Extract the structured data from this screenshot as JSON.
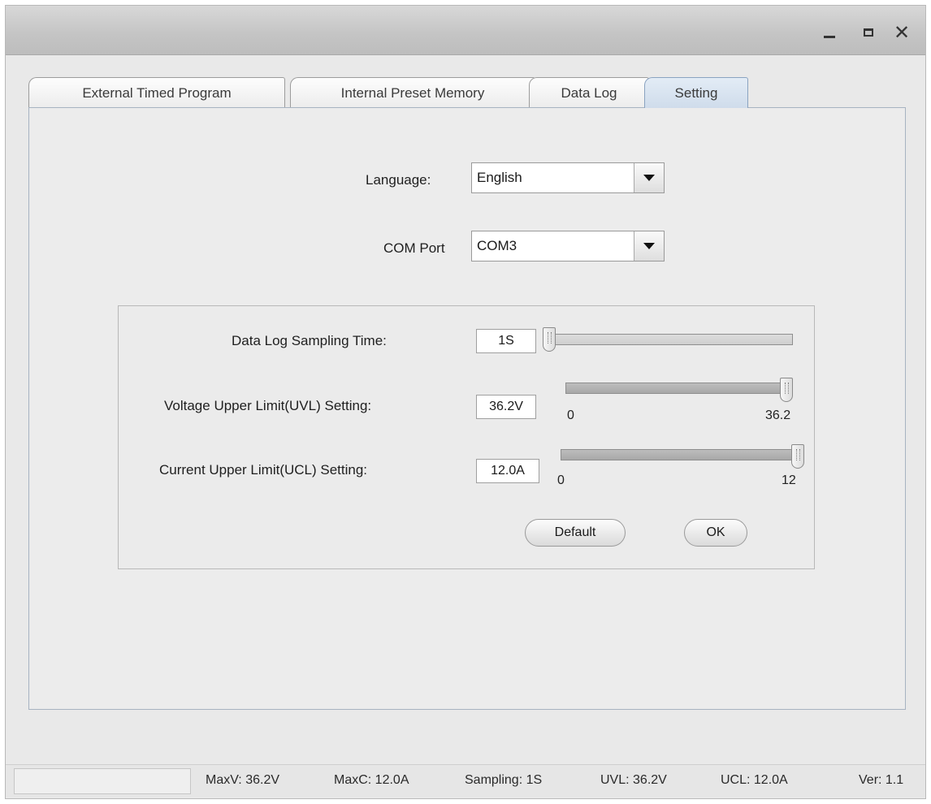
{
  "tabs": [
    {
      "label": "External Timed Program"
    },
    {
      "label": "Internal Preset Memory"
    },
    {
      "label": "Data Log"
    },
    {
      "label": "Setting"
    }
  ],
  "settings": {
    "language_label": "Language:",
    "language_value": "English",
    "com_port_label": "COM Port",
    "com_port_value": "COM3"
  },
  "limits": {
    "sampling_label": "Data Log Sampling Time:",
    "sampling_value": "1S",
    "sampling_slider_level": 0,
    "uvl_label": "Voltage Upper Limit(UVL) Setting:",
    "uvl_value": "36.2V",
    "uvl_min": "0",
    "uvl_max": "36.2",
    "uvl_slider_level": 1.0,
    "ucl_label": "Current Upper Limit(UCL) Setting:",
    "ucl_value": "12.0A",
    "ucl_min": "0",
    "ucl_max": "12",
    "ucl_slider_level": 1.0,
    "default_button": "Default",
    "ok_button": "OK"
  },
  "status": {
    "maxv": "MaxV: 36.2V",
    "maxc": "MaxC: 12.0A",
    "sampling": "Sampling: 1S",
    "uvl": "UVL: 36.2V",
    "ucl": "UCL: 12.0A",
    "version": "Ver: 1.1"
  },
  "window_controls": {
    "minimize_icon": "minimize-icon",
    "maximize_icon": "maximize-icon",
    "close_icon": "close-icon",
    "close_glyph": "✕"
  },
  "colors": {
    "active_tab": "#cfdceb",
    "panel_border": "#a7b3c1"
  }
}
